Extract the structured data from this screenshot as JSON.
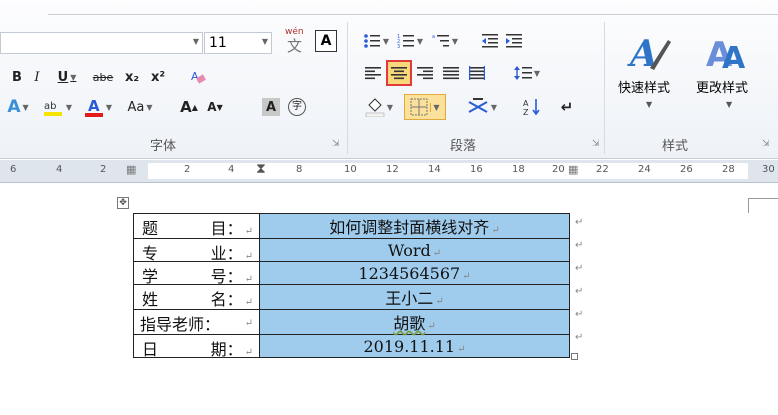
{
  "font_group": {
    "size_value": "11",
    "wen_glyph": "wén",
    "wen_char": "文",
    "a_box": "A",
    "bold": "B",
    "italic": "I",
    "underline": "U",
    "strike": "abe",
    "subscript": "x₂",
    "superscript": "x²",
    "aa_label": "Aa",
    "grow": "A",
    "shrink": "A",
    "charshade": "A",
    "enclose": "字",
    "label": "字体"
  },
  "paragraph_group": {
    "label": "段落"
  },
  "styles_group": {
    "quick_styles": "快速样式",
    "change_styles": "更改样式",
    "label": "样式"
  },
  "ruler": {
    "numbers": [
      "6",
      "4",
      "2",
      "2",
      "4",
      "8",
      "10",
      "12",
      "14",
      "16",
      "18",
      "20",
      "22",
      "24",
      "26",
      "28",
      "30"
    ]
  },
  "table": {
    "rows": [
      {
        "l": "题",
        "r": "目：",
        "value": "如何调整封面横线对齐"
      },
      {
        "l": "专",
        "r": "业：",
        "value": "Word"
      },
      {
        "l": "学",
        "r": "号：",
        "value": "1234564567"
      },
      {
        "l": "姓",
        "r": "名：",
        "value": "王小二"
      },
      {
        "l": "指导老师：",
        "r": "",
        "value": "胡歌"
      },
      {
        "l": "日",
        "r": "期：",
        "value": "2019.11.11"
      }
    ]
  },
  "colors": {
    "highlight": "#9fcbed",
    "selected_button_border": "#e03b3b",
    "accent": "#2a5bd7"
  }
}
